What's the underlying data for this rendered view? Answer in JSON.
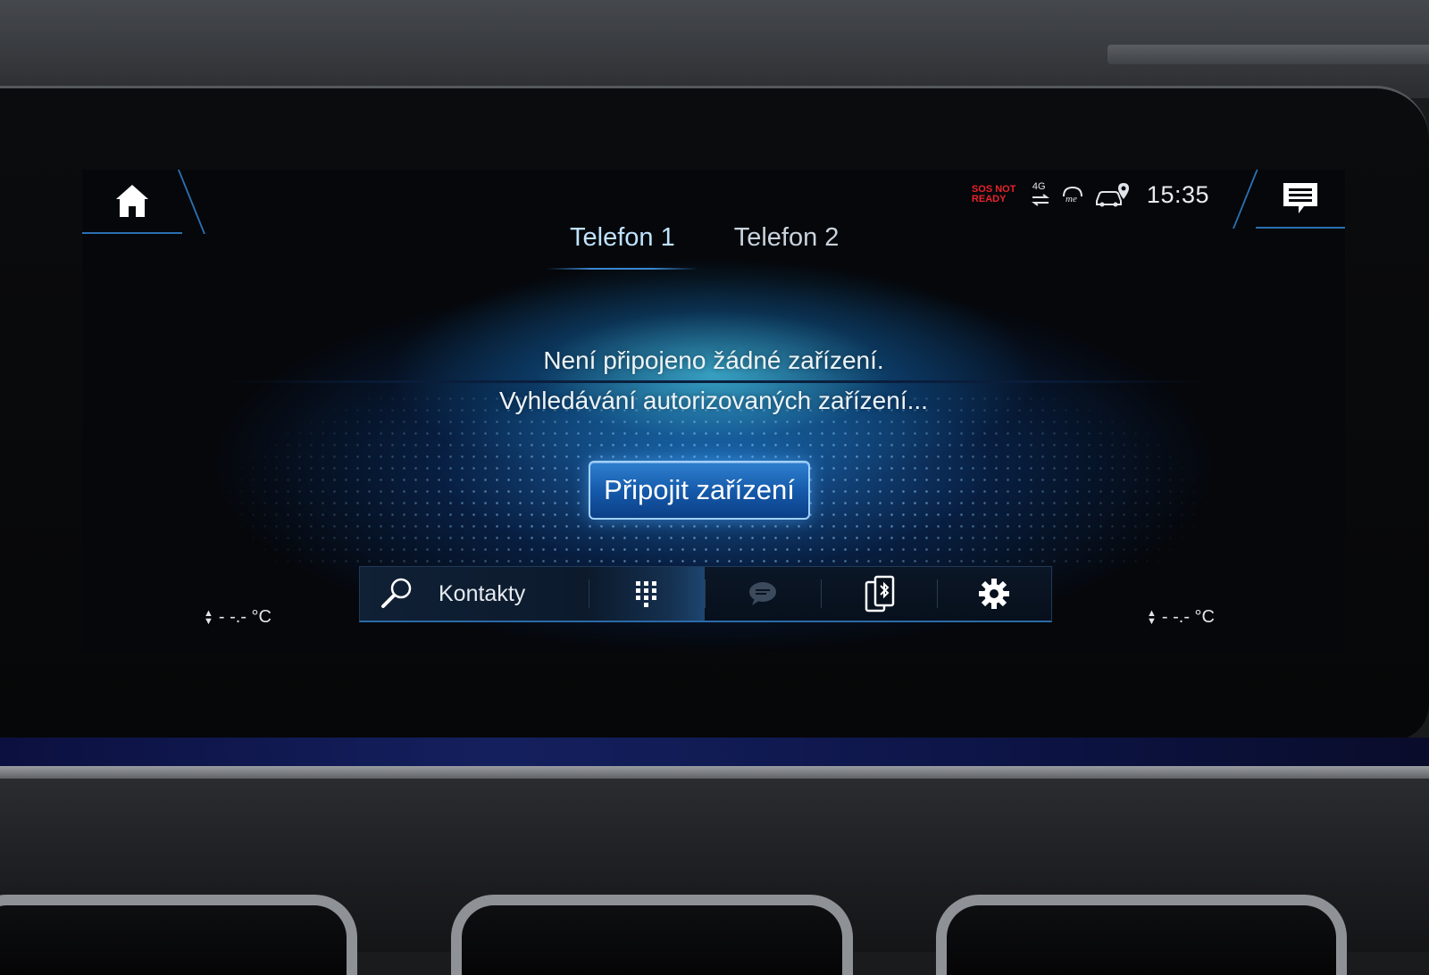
{
  "status_bar": {
    "sos_line1": "SOS NOT",
    "sos_line2": "READY",
    "network": "4G",
    "time": "15:35",
    "sos_color": "#e8232b"
  },
  "tabs": [
    {
      "label": "Telefon 1",
      "active": true
    },
    {
      "label": "Telefon 2",
      "active": false
    }
  ],
  "message": {
    "line1": "Není připojeno žádné zařízení.",
    "line2": "Vyhledávání autorizovaných zařízení..."
  },
  "connect_button": {
    "label": "Připojit zařízení"
  },
  "toolbar": {
    "search_label": "Kontakty",
    "items": [
      "search-icon",
      "keypad-icon",
      "chat-bubble-icon",
      "phone-bluetooth-icon",
      "gear-icon"
    ]
  },
  "climate": {
    "left_temp": "- -.- °C",
    "right_temp": "- -.- °C"
  },
  "colors": {
    "accent": "#2c6fb0",
    "button": "#1458a8"
  }
}
